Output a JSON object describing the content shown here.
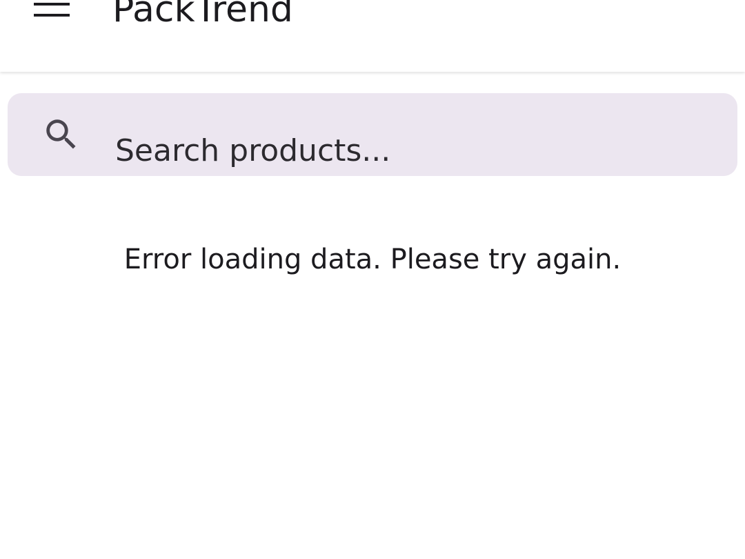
{
  "app_bar": {
    "title": "PackTrend",
    "menu_icon": "menu-icon"
  },
  "search": {
    "placeholder": "Search products...",
    "value": "",
    "icon": "search-icon",
    "background_color": "#ece6f0"
  },
  "status": {
    "message": "Error loading data. Please try again."
  },
  "colors": {
    "text": "#1c1b1f",
    "background": "#ffffff"
  }
}
